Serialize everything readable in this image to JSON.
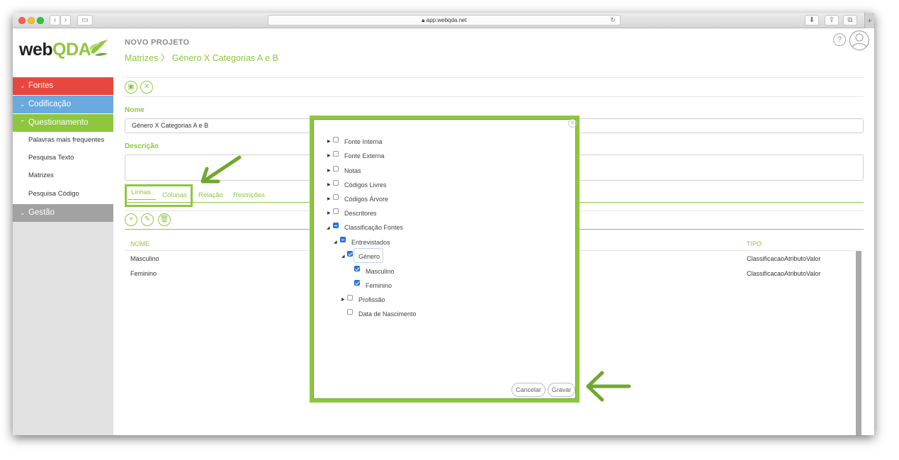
{
  "browser": {
    "url": "app.webqda.net"
  },
  "logo": {
    "part1": "web",
    "part2": "QDA"
  },
  "sidebar": {
    "fontes": "Fontes",
    "codificacao": "Codificação",
    "questionamento": "Questionamento",
    "sub_items": [
      "Palavras mais frequentes",
      "Pesquisa Texto",
      "Matrizes",
      "Pesquisa Código"
    ],
    "gestao": "Gestão"
  },
  "colors": {
    "fontes": "#e8473f",
    "codificacao": "#6aaadf",
    "questionamento": "#8ec63f",
    "gestao": "#a2a2a2",
    "accent": "#8ec63f"
  },
  "header": {
    "project": "NOVO PROJETO",
    "breadcrumb_root": "Matrizes",
    "breadcrumb_sep": "〉",
    "breadcrumb_current": "Género X Categorias A e B",
    "help_icon": "?"
  },
  "form": {
    "nome_label": "Nome",
    "nome_value": "Género X Categorias A e B",
    "descricao_label": "Descrição",
    "descricao_value": ""
  },
  "tabs": [
    "Linhas",
    "Colunas",
    "Relação",
    "Restrições"
  ],
  "table": {
    "headers": {
      "nome": "NOME",
      "tipo": "TIPO"
    },
    "rows": [
      {
        "nome": "Masculino",
        "tipo": "ClassificacaoAtributoValor"
      },
      {
        "nome": "Feminino",
        "tipo": "ClassificacaoAtributoValor"
      }
    ]
  },
  "modal": {
    "tree": [
      "Fonte Interna",
      "Fonte Externa",
      "Notas",
      "Códigos Livres",
      "Códigos Árvore",
      "Descritores",
      "Classificação Fontes",
      "Entrevistados",
      "Género",
      "Masculino",
      "Feminino",
      "Profissão",
      "Data de Nascimento"
    ],
    "cancel": "Cancelar",
    "save": "Gravar"
  },
  "icons": [
    "save-icon",
    "cancel-icon",
    "add-icon",
    "edit-icon",
    "delete-icon",
    "help-icon",
    "user-icon",
    "close-icon",
    "reload-icon",
    "leaf-logo-icon"
  ]
}
